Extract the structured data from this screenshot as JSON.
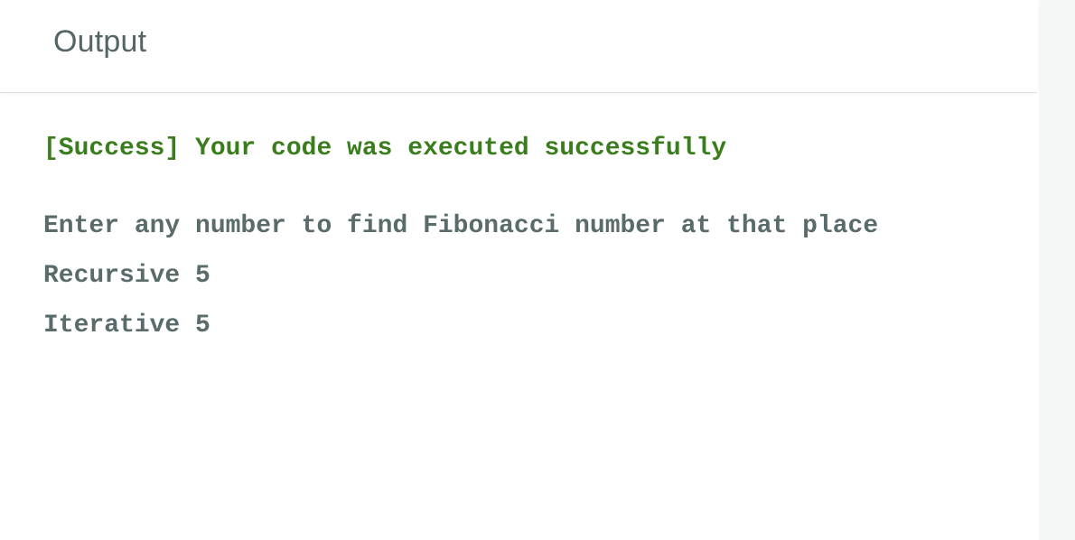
{
  "panel": {
    "title": "Output"
  },
  "console": {
    "status_line": "[Success] Your code was executed successfully",
    "lines": [
      "Enter any number to find Fibonacci number at that place",
      "Recursive 5",
      "Iterative 5"
    ]
  },
  "colors": {
    "success": "#3a7d1c",
    "text": "#5a6b6c",
    "title": "#546566"
  }
}
